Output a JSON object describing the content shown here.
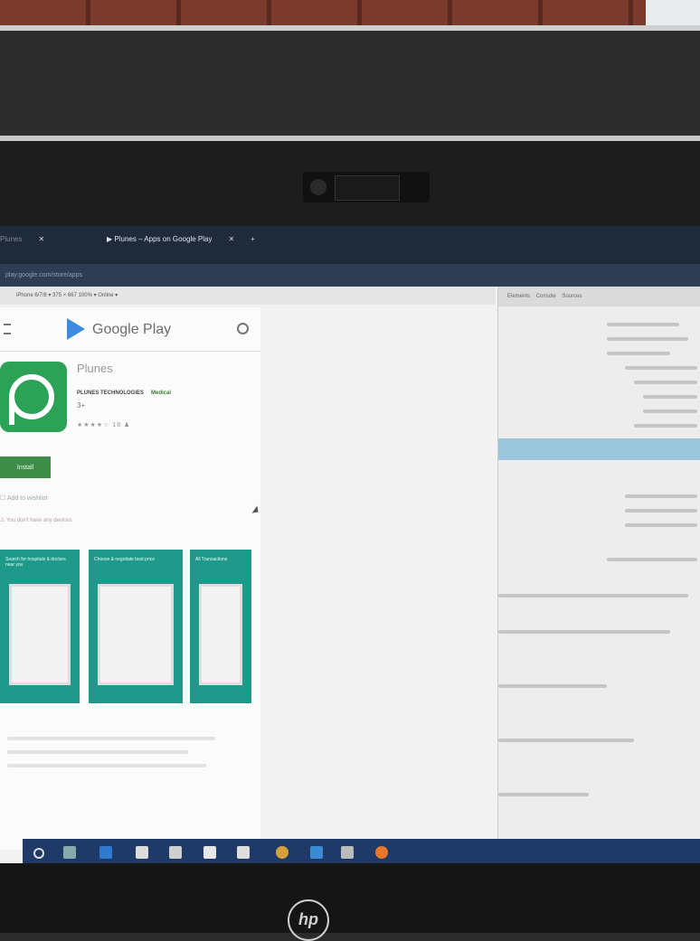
{
  "browser": {
    "tabs": [
      {
        "label": "Plunes"
      },
      {
        "label": "Plunes – Apps on Google Play"
      }
    ],
    "address": "play.google.com/store/apps",
    "device_toolbar": "iPhone 6/7/8 ▾   375  ×  667   100% ▾  Online ▾"
  },
  "devtools": {
    "tabs": [
      "Elements",
      "Console",
      "Sources"
    ]
  },
  "store": {
    "name": "Google Play",
    "app_name": "Plunes",
    "developer": "PLUNES TECHNOLOGIES",
    "category": "Medical",
    "age_rating": "3+",
    "rating_text": "★★★★☆ 18 ♟",
    "install_label": "Install",
    "wishlist_label": "Add to wishlist",
    "notice": "You don't have any devices"
  },
  "screenshots": [
    {
      "caption": "Search for hospitals & doctors near you"
    },
    {
      "caption": "Choose & negotiate best price"
    },
    {
      "caption": "All Transactions"
    }
  ],
  "colors": {
    "play_green": "#2ba255",
    "install_green": "#3e8e4a",
    "teal": "#1f9a8a",
    "taskbar": "#1f3a66"
  },
  "taskbar_icons": [
    "start-icon",
    "task-view-icon",
    "edge-icon",
    "explorer-icon",
    "store-icon",
    "mail-icon",
    "app-icon",
    "chrome-icon",
    "terminal-icon",
    "files-icon",
    "firefox-icon"
  ],
  "brand": "hp"
}
